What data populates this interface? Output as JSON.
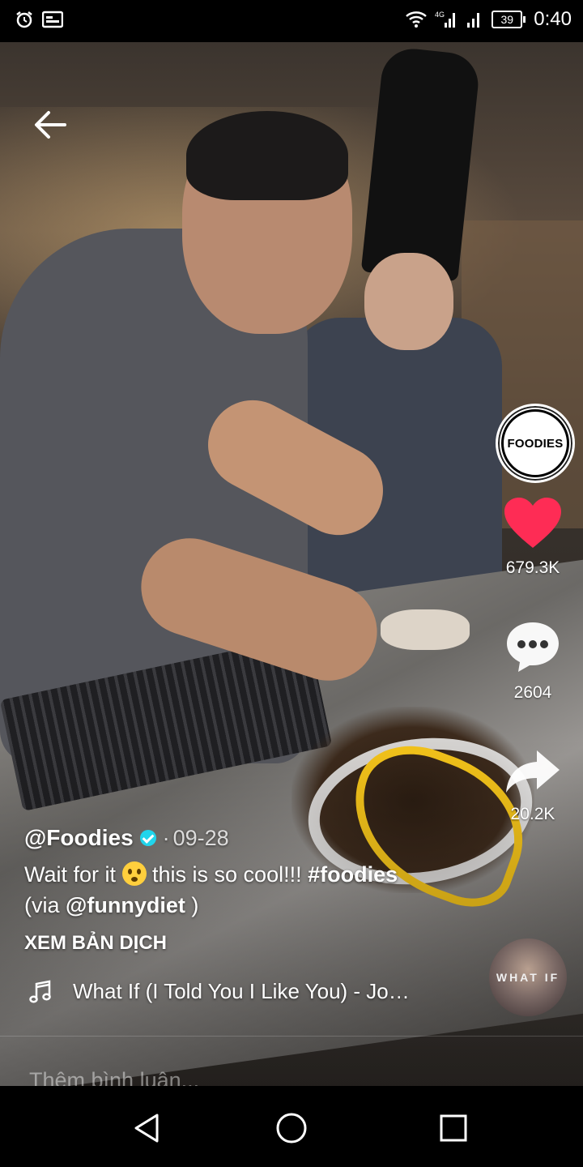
{
  "status_bar": {
    "time": "0:40",
    "battery": "39",
    "left_icons": [
      "alarm-icon",
      "message-icon"
    ],
    "right_icons": [
      "wifi-icon",
      "signal-4g-icon",
      "signal-icon",
      "battery-icon"
    ],
    "signal_label": "4G"
  },
  "video": {
    "back_icon": "arrow-left-icon"
  },
  "creator": {
    "avatar_text": "FOODIES"
  },
  "actions": {
    "likes": "679.3K",
    "comments": "2604",
    "shares": "20.2K",
    "like_color": "#fe2c55"
  },
  "caption": {
    "username": "@Foodies",
    "date_sep": "·",
    "date": "09-28",
    "text_before": "Wait for it ",
    "text_after": " this is so cool!!! ",
    "hashtag": "#foodies",
    "via_prefix": "(via ",
    "via_user": "@funnydiet",
    "via_suffix": " )",
    "translate": "XEM BẢN DỊCH"
  },
  "music": {
    "title": "What If (I Told You I Like You) - Jo…",
    "disc_text": "WHAT IF"
  },
  "comment": {
    "placeholder": "Thêm bình luận..."
  },
  "nav": {
    "icons": [
      "back-triangle-icon",
      "home-circle-icon",
      "recents-square-icon"
    ]
  }
}
